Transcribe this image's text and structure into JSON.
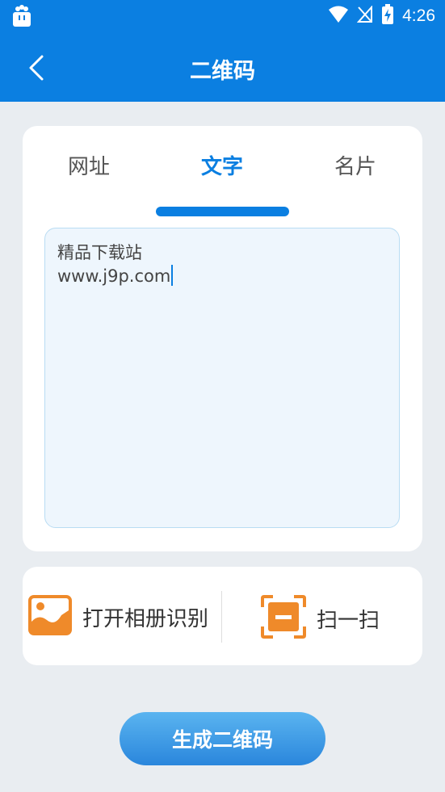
{
  "status_bar": {
    "time": "4:26"
  },
  "app_bar": {
    "title": "二维码"
  },
  "tabs": [
    {
      "label": "网址"
    },
    {
      "label": "文字"
    },
    {
      "label": "名片"
    }
  ],
  "text_input": {
    "line1": "精品下载站",
    "line2": "www.j9p.com"
  },
  "actions": {
    "album_label": "打开相册识别",
    "scan_label": "扫一扫"
  },
  "generate_button": {
    "label": "生成二维码"
  },
  "colors": {
    "primary": "#0b7fe1",
    "accent_orange": "#ef8a2a",
    "background": "#e9edf1"
  }
}
